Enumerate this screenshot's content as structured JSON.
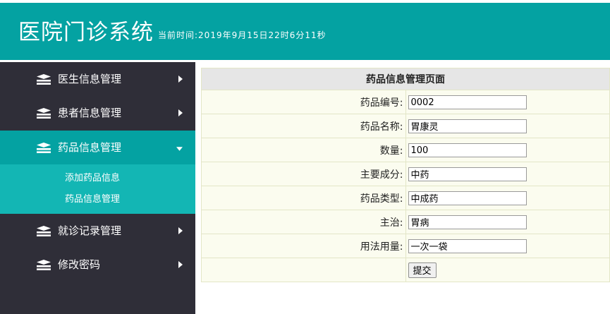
{
  "header": {
    "app_title": "医院门诊系统",
    "clock": "当前时间:2019年9月15日22时6分11秒",
    "bg_color": "#04a2a2"
  },
  "sidebar": {
    "items": [
      {
        "label": "医生信息管理",
        "icon": "stack-icon",
        "caret": "chevron-right-icon"
      },
      {
        "label": "患者信息管理",
        "icon": "stack-icon",
        "caret": "chevron-right-icon"
      },
      {
        "label": "药品信息管理",
        "icon": "stack-icon",
        "caret": "chevron-down-icon",
        "active": true
      },
      {
        "label": "就诊记录管理",
        "icon": "stack-icon",
        "caret": "chevron-right-icon"
      },
      {
        "label": "修改密码",
        "icon": "stack-icon",
        "caret": "chevron-right-icon"
      }
    ],
    "subitems": [
      "添加药品信息",
      "药品信息管理"
    ],
    "bg_color": "#2f2e38",
    "active_color": "#04a2a2",
    "sub_bg_color": "#13b6b4"
  },
  "form": {
    "title": "药品信息管理页面",
    "fields": [
      {
        "label": "药品编号:",
        "value": "0002"
      },
      {
        "label": "药品名称:",
        "value": "胃康灵"
      },
      {
        "label": "数量:",
        "value": "100"
      },
      {
        "label": "主要成分:",
        "value": "中药"
      },
      {
        "label": "药品类型:",
        "value": "中成药"
      },
      {
        "label": "主治:",
        "value": "胃病"
      },
      {
        "label": "用法用量:",
        "value": "一次一袋"
      }
    ],
    "submit_label": "提交"
  }
}
